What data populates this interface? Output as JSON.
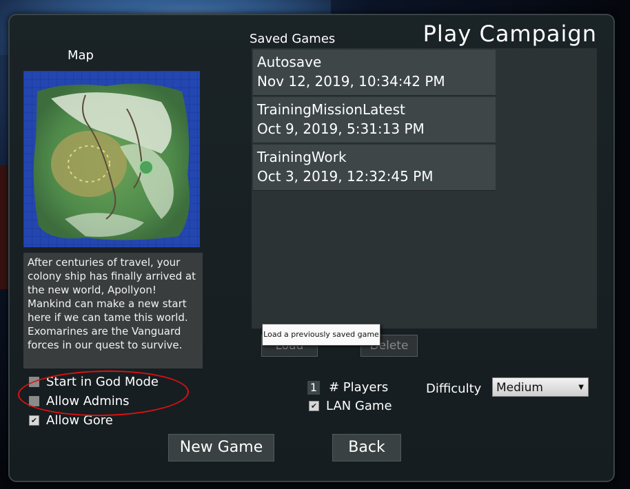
{
  "title": "Play Campaign",
  "map": {
    "label": "Map",
    "description": "After centuries of travel, your colony ship has finally arrived at the new world, Apollyon! Mankind can make a new start here if we can tame this world. Exomarines are the Vanguard forces in our quest to survive."
  },
  "saved_games": {
    "label": "Saved Games",
    "items": [
      {
        "name": "Autosave",
        "date": "Nov 12, 2019, 10:34:42 PM"
      },
      {
        "name": "TrainingMissionLatest",
        "date": "Oct 9, 2019, 5:31:13 PM"
      },
      {
        "name": "TrainingWork",
        "date": "Oct 3, 2019, 12:32:45 PM"
      }
    ],
    "load_label": "Load",
    "delete_label": "Delete",
    "tooltip": "Load a previously saved game"
  },
  "options": {
    "god_mode": {
      "label": "Start in God Mode",
      "checked": false
    },
    "allow_admins": {
      "label": "Allow Admins",
      "checked": false
    },
    "allow_gore": {
      "label": "Allow Gore",
      "checked": true
    },
    "players_count": "1",
    "players_label": "# Players",
    "lan_game": {
      "label": "LAN Game",
      "checked": true
    },
    "difficulty_label": "Difficulty",
    "difficulty_value": "Medium"
  },
  "buttons": {
    "new_game": "New Game",
    "back": "Back"
  },
  "colors": {
    "annotation_circle": "#dd1111"
  }
}
